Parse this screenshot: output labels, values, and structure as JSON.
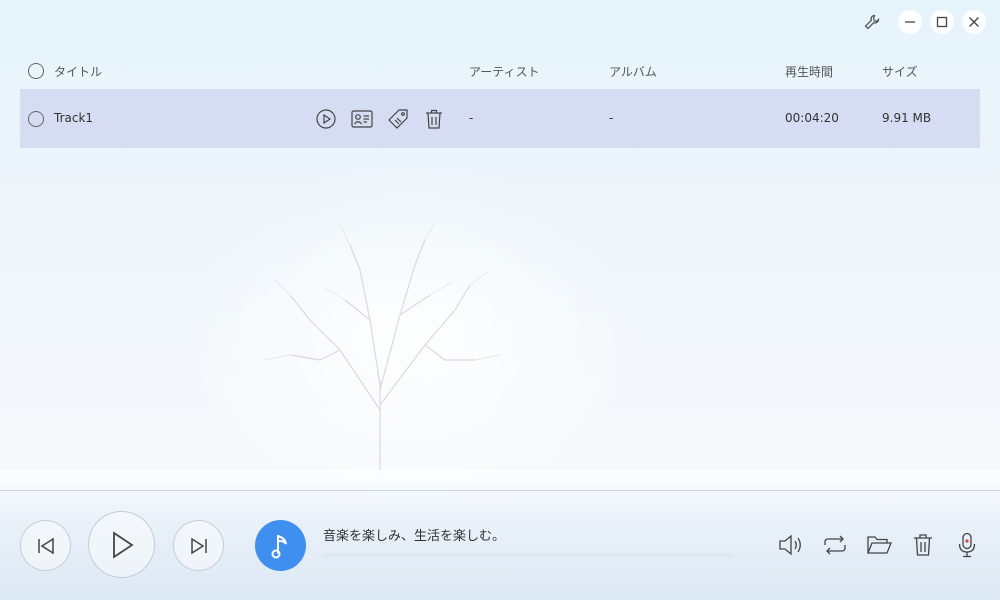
{
  "table": {
    "headers": {
      "title": "タイトル",
      "artist": "アーティスト",
      "album": "アルバム",
      "duration": "再生時間",
      "size": "サイズ"
    },
    "rows": [
      {
        "title": "Track1",
        "artist": "-",
        "album": "-",
        "duration": "00:04:20",
        "size": "9.91 MB"
      }
    ]
  },
  "player": {
    "now_playing": "音楽を楽しみ、生活を楽しむ。",
    "progress": 0
  },
  "icons": {
    "window": [
      "wrench-icon",
      "minimize-icon",
      "maximize-icon",
      "close-icon"
    ],
    "row_actions": [
      "play-circle-icon",
      "contact-card-icon",
      "tag-icon",
      "trash-icon"
    ],
    "player_controls": [
      "skip-previous-icon",
      "play-icon",
      "skip-next-icon"
    ],
    "tools": [
      "volume-icon",
      "repeat-icon",
      "folder-icon",
      "trash-icon",
      "microphone-icon"
    ]
  },
  "colors": {
    "accent": "#3f8ff0",
    "selected_row": "#cdd4ee",
    "record_dot": "#e03c3c"
  }
}
